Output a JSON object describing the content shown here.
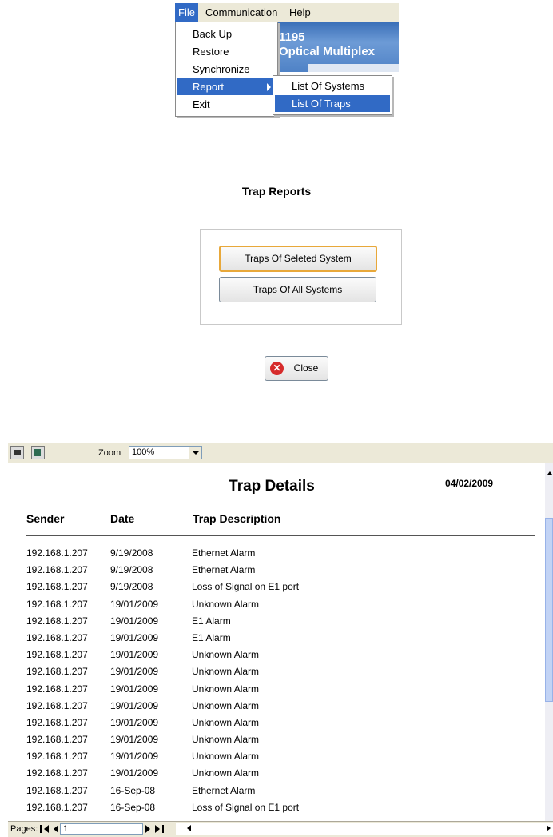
{
  "menubar": {
    "items": [
      {
        "label": "File"
      },
      {
        "label": "Communication"
      },
      {
        "label": "Help"
      }
    ]
  },
  "banner": {
    "line1": "1195",
    "line2": "Optical Multiplex"
  },
  "file_menu": {
    "items": [
      {
        "label": "Back Up"
      },
      {
        "label": "Restore"
      },
      {
        "label": "Synchronize"
      },
      {
        "label": "Report"
      },
      {
        "label": "Exit"
      }
    ]
  },
  "report_submenu": {
    "items": [
      {
        "label": "List Of Systems"
      },
      {
        "label": "List Of Traps"
      }
    ]
  },
  "trap_reports": {
    "title": "Trap Reports",
    "btn_selected": "Traps Of Seleted System",
    "btn_all": "Traps Of All Systems",
    "btn_close": "Close"
  },
  "viewer": {
    "zoom_label": "Zoom",
    "zoom_value": "100%",
    "report_title": "Trap Details",
    "report_date": "04/02/2009",
    "columns": [
      "Sender",
      "Date",
      "Trap Description"
    ],
    "rows": [
      [
        "192.168.1.207",
        "9/19/2008",
        "Ethernet Alarm"
      ],
      [
        "192.168.1.207",
        "9/19/2008",
        "Ethernet Alarm"
      ],
      [
        "192.168.1.207",
        "9/19/2008",
        "Loss of Signal on E1 port"
      ],
      [
        "192.168.1.207",
        "19/01/2009",
        "Unknown Alarm"
      ],
      [
        "192.168.1.207",
        "19/01/2009",
        "E1 Alarm"
      ],
      [
        "192.168.1.207",
        "19/01/2009",
        "E1 Alarm"
      ],
      [
        "192.168.1.207",
        "19/01/2009",
        "Unknown Alarm"
      ],
      [
        "192.168.1.207",
        "19/01/2009",
        "Unknown Alarm"
      ],
      [
        "192.168.1.207",
        "19/01/2009",
        "Unknown Alarm"
      ],
      [
        "192.168.1.207",
        "19/01/2009",
        "Unknown Alarm"
      ],
      [
        "192.168.1.207",
        "19/01/2009",
        "Unknown Alarm"
      ],
      [
        "192.168.1.207",
        "19/01/2009",
        "Unknown Alarm"
      ],
      [
        "192.168.1.207",
        "19/01/2009",
        "Unknown Alarm"
      ],
      [
        "192.168.1.207",
        "19/01/2009",
        "Unknown Alarm"
      ],
      [
        "192.168.1.207",
        "16-Sep-08",
        "Ethernet Alarm"
      ],
      [
        "192.168.1.207",
        "16-Sep-08",
        "Loss of Signal on E1 port"
      ]
    ],
    "pages_label": "Pages:",
    "page_value": "1"
  }
}
